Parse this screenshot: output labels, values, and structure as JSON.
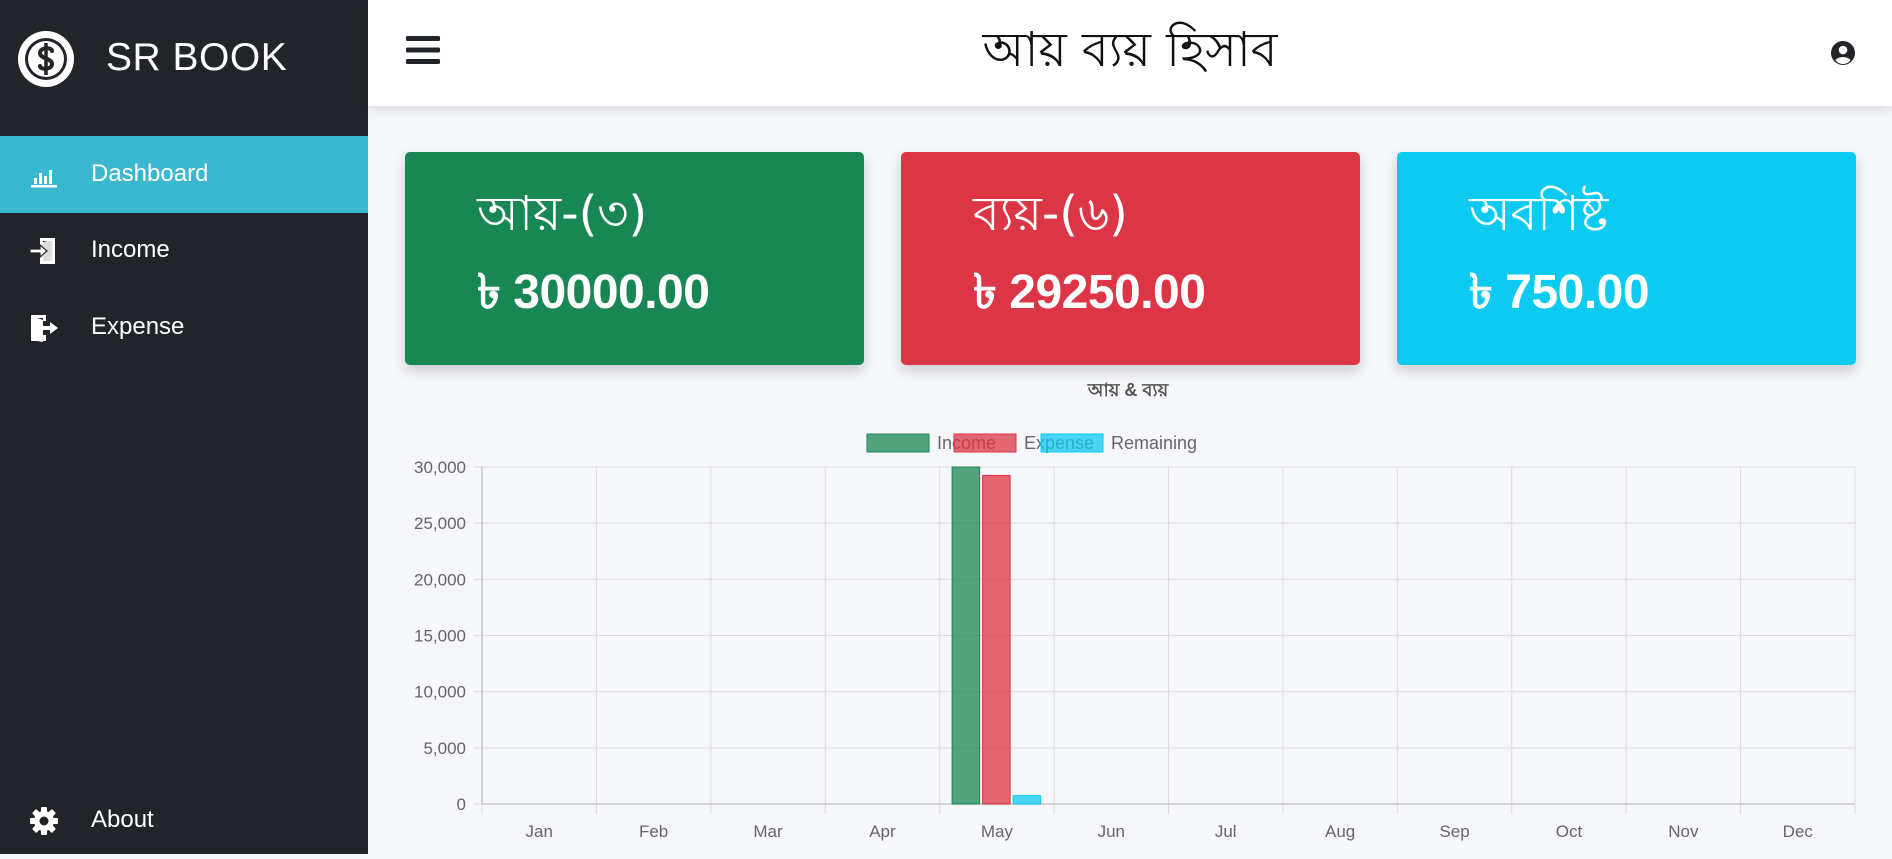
{
  "sidebar": {
    "brand_name": "SR BOOK",
    "brand_icon": "dollar-circle-icon",
    "items": [
      {
        "label": "Dashboard",
        "icon": "bar-chart-icon",
        "active": true
      },
      {
        "label": "Income",
        "icon": "sign-in-icon",
        "active": false
      },
      {
        "label": "Expense",
        "icon": "sign-out-icon",
        "active": false
      },
      {
        "label": "About",
        "icon": "gear-icon",
        "active": false
      }
    ]
  },
  "header": {
    "title": "আয় ব্যয় হিসাব",
    "menu_icon": "hamburger-icon",
    "user_icon": "user-circle-icon"
  },
  "cards": [
    {
      "title": "আয়-(৩)",
      "value": "৳ 30000.00",
      "color": "#198754"
    },
    {
      "title": "ব্যয়-(৬)",
      "value": "৳ 29250.00",
      "color": "#dc3545"
    },
    {
      "title": "অবশিষ্ট",
      "value": "৳ 750.00",
      "color": "#0dcaf0"
    }
  ],
  "chart_data": {
    "type": "bar",
    "title": "আয় & ব্যয়",
    "categories": [
      "Jan",
      "Feb",
      "Mar",
      "Apr",
      "May",
      "Jun",
      "Jul",
      "Aug",
      "Sep",
      "Oct",
      "Nov",
      "Dec"
    ],
    "series": [
      {
        "name": "Income",
        "color": "#198754",
        "values": [
          0,
          0,
          0,
          0,
          30000,
          0,
          0,
          0,
          0,
          0,
          0,
          0
        ]
      },
      {
        "name": "Expense",
        "color": "#dc3545",
        "values": [
          0,
          0,
          0,
          0,
          29250,
          0,
          0,
          0,
          0,
          0,
          0,
          0
        ]
      },
      {
        "name": "Remaining",
        "color": "#0dcaf0",
        "values": [
          0,
          0,
          0,
          0,
          750,
          0,
          0,
          0,
          0,
          0,
          0,
          0
        ]
      }
    ],
    "ylim": [
      0,
      30000
    ],
    "yticks": [
      0,
      5000,
      10000,
      15000,
      20000,
      25000,
      30000
    ],
    "ytick_labels": [
      "0",
      "5,000",
      "10,000",
      "15,000",
      "20,000",
      "25,000",
      "30,000"
    ],
    "grid": true,
    "legend": "top-center"
  }
}
